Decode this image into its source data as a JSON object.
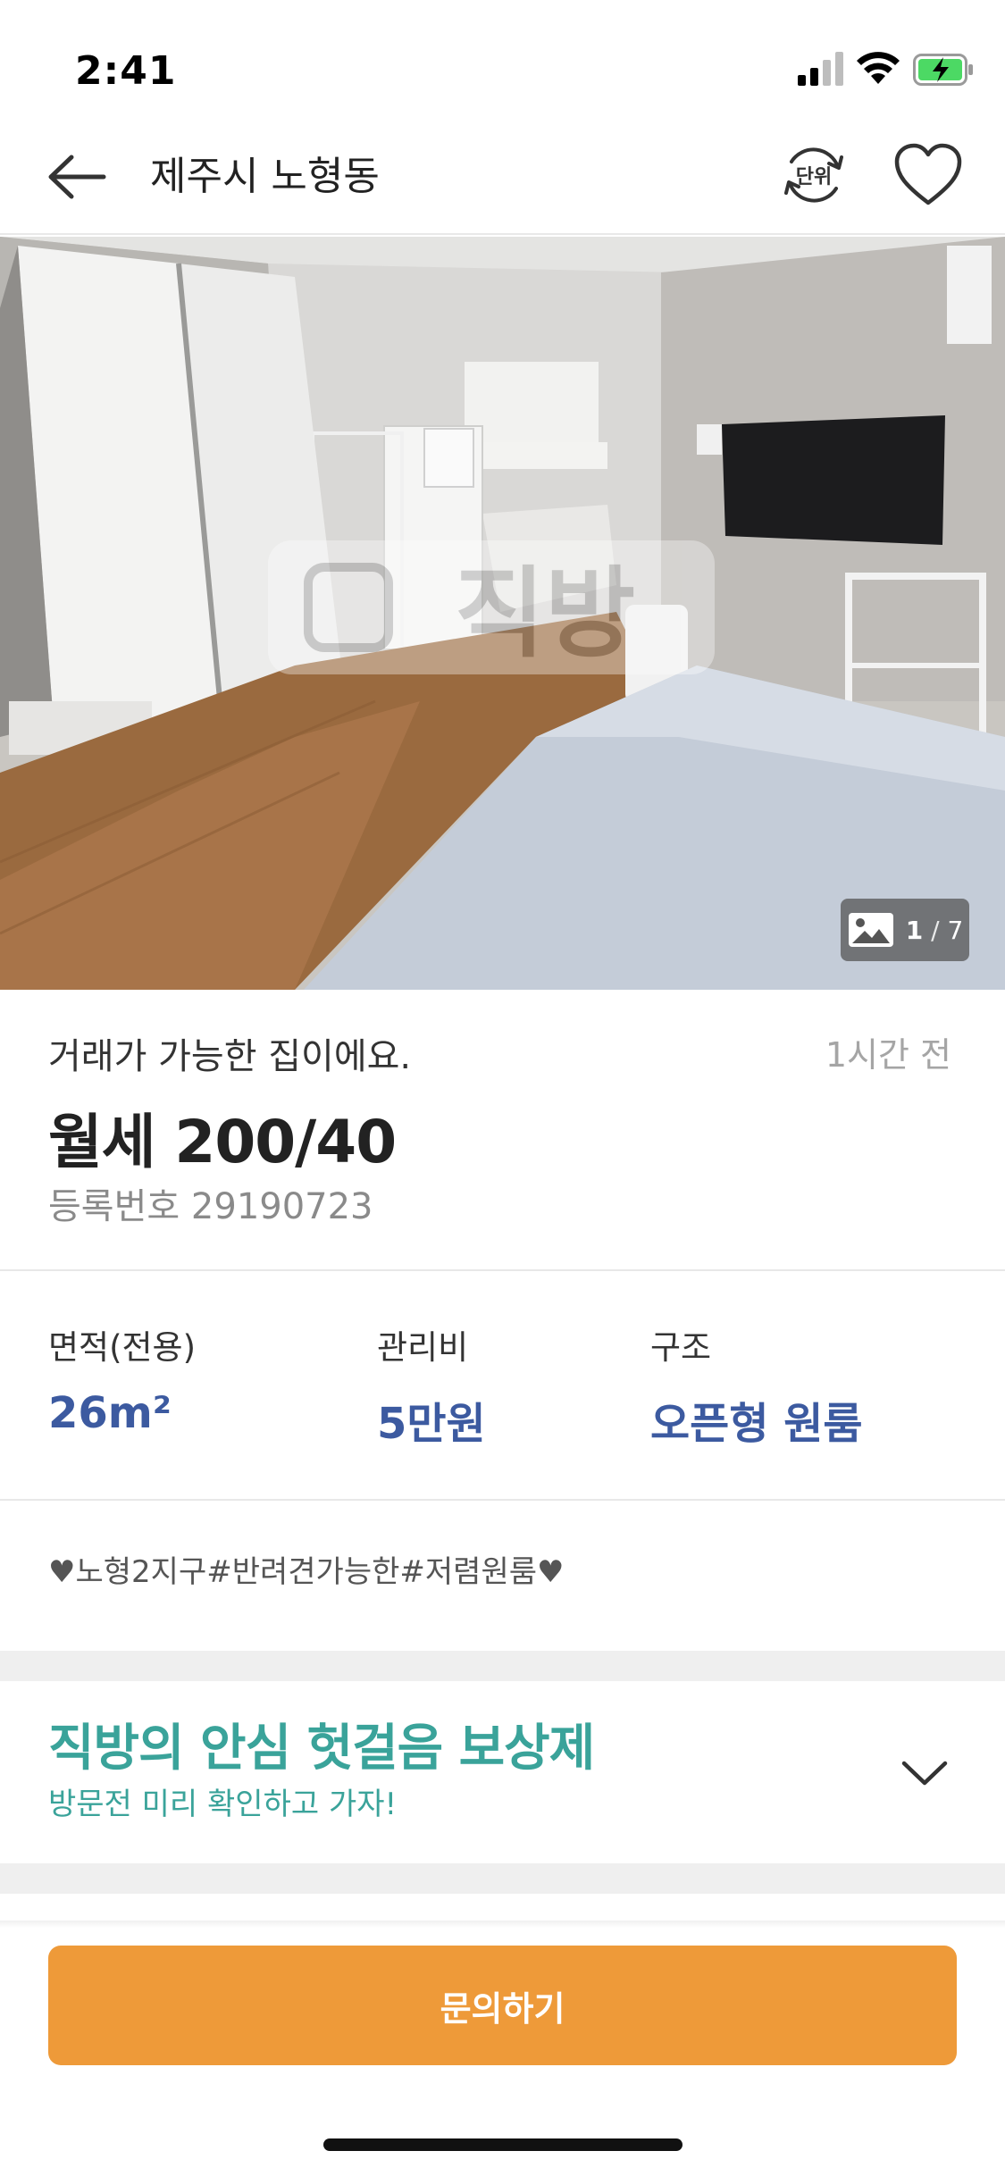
{
  "status_bar": {
    "time": "2:41"
  },
  "nav": {
    "title": "제주시 노형동",
    "unit_label": "단위",
    "icons": {
      "back": "arrow-left-icon",
      "unit": "unit-toggle-icon",
      "favorite": "heart-icon"
    }
  },
  "photo": {
    "watermark": "직방",
    "counter_current": "1",
    "counter_total": "7",
    "icon": "image-icon"
  },
  "listing": {
    "status_text": "거래가 가능한 집이에요.",
    "time_ago": "1시간 전",
    "price": "월세 200/40",
    "registration": "등록번호 29190723"
  },
  "specs": [
    {
      "label": "면적(전용)",
      "value": "26m²"
    },
    {
      "label": "관리비",
      "value": "5만원"
    },
    {
      "label": "구조",
      "value": "오픈형 원룸"
    }
  ],
  "tags": "♥노형2지구#반려견가능한#저렴원룸♥",
  "promo": {
    "title": "직방의 안심 헛걸음 보상제",
    "subtitle": "방문전 미리 확인하고 가자!"
  },
  "cta": {
    "label": "문의하기"
  },
  "colors": {
    "accent_orange": "#ee9a39",
    "spec_blue": "#3c5aa0",
    "promo_teal": "#3aa39a"
  }
}
